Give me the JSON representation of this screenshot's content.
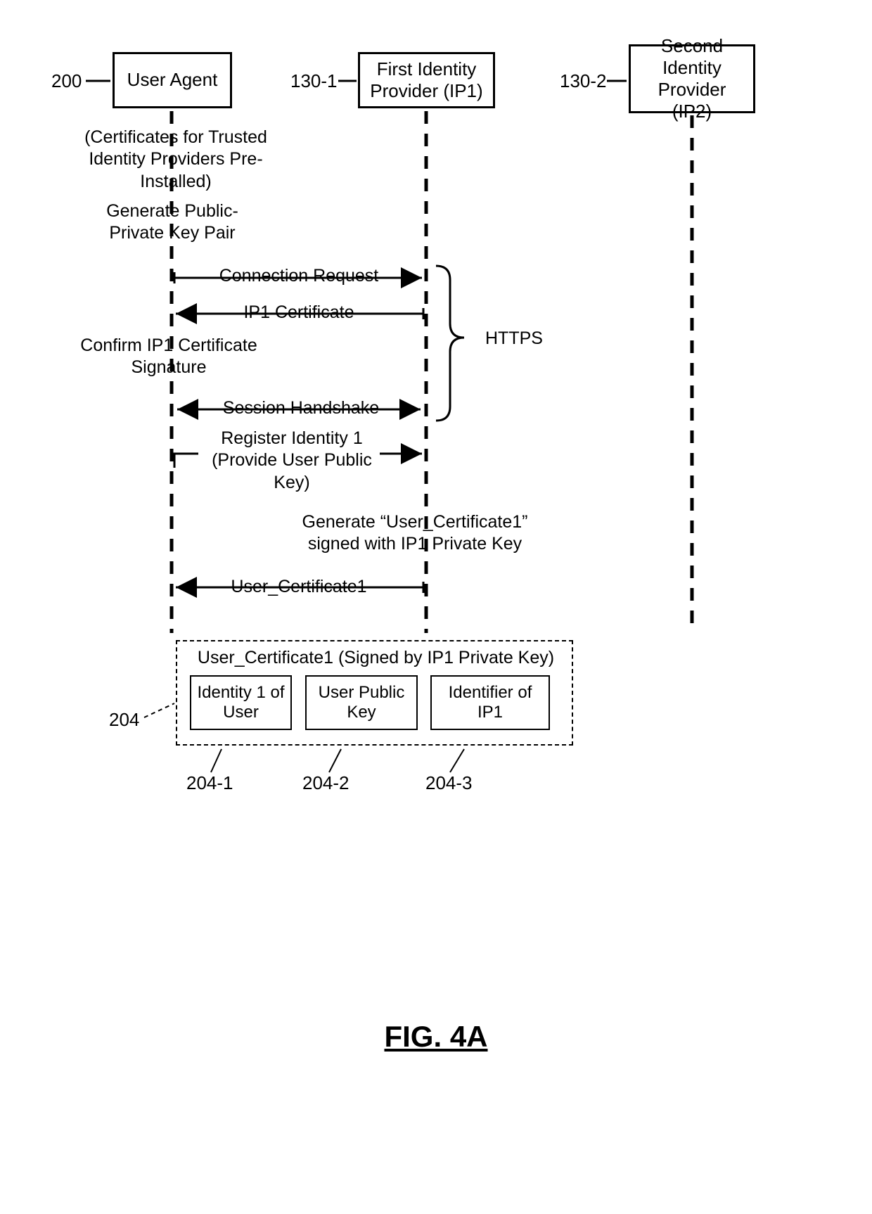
{
  "participants": {
    "userAgent": {
      "label": "User Agent",
      "ref": "200"
    },
    "ip1": {
      "label": "First Identity Provider (IP1)",
      "ref": "130-1"
    },
    "ip2": {
      "label": "Second Identity Provider (IP2)",
      "ref": "130-2"
    }
  },
  "notes": {
    "preInstalled": "(Certificates for Trusted Identity Providers Pre-Installed)",
    "genKeyPair": "Generate Public-Private Key Pair",
    "confirmCert": "Confirm IP1 Certificate Signature",
    "genUserCert": "Generate “User_Certificate1” signed with IP1 Private Key",
    "httpsLabel": "HTTPS"
  },
  "messages": {
    "connReq": "Connection Request",
    "ip1Cert": "IP1 Certificate",
    "sessionHandshake": "Session Handshake",
    "registerIdentity": "Register Identity 1 (Provide User Public Key)",
    "userCert1": "User_Certificate1"
  },
  "certificate": {
    "title": "User_Certificate1 (Signed by IP1 Private Key)",
    "ref": "204",
    "fields": {
      "identity": {
        "label": "Identity 1 of User",
        "ref": "204-1"
      },
      "pubkey": {
        "label": "User Public Key",
        "ref": "204-2"
      },
      "issuer": {
        "label": "Identifier of IP1",
        "ref": "204-3"
      }
    }
  },
  "figure": "FIG. 4A"
}
